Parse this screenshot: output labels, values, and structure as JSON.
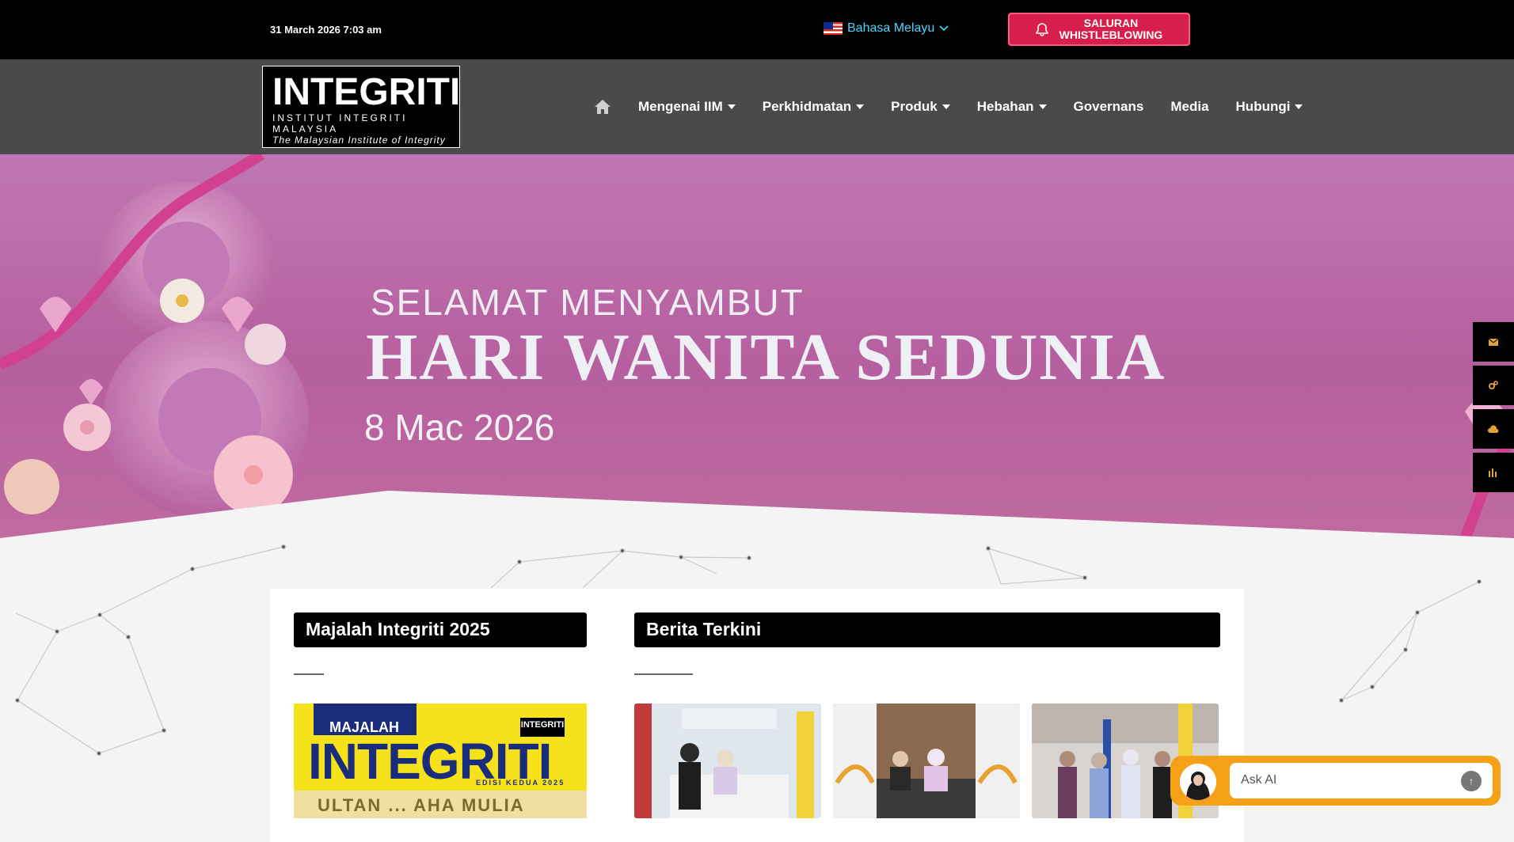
{
  "topbar": {
    "datetime": "31 March 2026 7:03 am",
    "language": "Bahasa Melayu",
    "whistleblowing_line1": "SALURAN",
    "whistleblowing_line2": "WHISTLEBLOWING"
  },
  "logo": {
    "title": "INTEGRITI",
    "subtitle": "INSTITUT INTEGRITI MALAYSIA",
    "english": "The Malaysian Institute of Integrity"
  },
  "nav": {
    "items": [
      {
        "label": "Mengenai IIM",
        "dropdown": true
      },
      {
        "label": "Perkhidmatan",
        "dropdown": true
      },
      {
        "label": "Produk",
        "dropdown": true
      },
      {
        "label": "Hebahan",
        "dropdown": true
      },
      {
        "label": "Governans",
        "dropdown": false
      },
      {
        "label": "Media",
        "dropdown": false
      },
      {
        "label": "Hubungi",
        "dropdown": true
      }
    ]
  },
  "hero": {
    "line1": "SELAMAT MENYAMBUT",
    "line2": "HARI WANITA SEDUNIA",
    "line3": "8 Mac 2026"
  },
  "sections": {
    "magazine_title": "Majalah Integriti 2025",
    "news_title": "Berita Terkini"
  },
  "magazine": {
    "majalah": "MAJALAH",
    "title": "INTEGRITI",
    "logo": "INTEGRITI",
    "edition": "EDISI KEDUA 2025",
    "strip": "ULTAN ... AHA MULIA"
  },
  "askai": {
    "placeholder": "Ask AI",
    "send_icon": "arrow-up-icon"
  },
  "colors": {
    "topbar": "#000000",
    "navbar": "#4a4a4a",
    "whistleblowing": "#d81e4a",
    "accessibility": "#e0a03a",
    "askai": "#f5a117",
    "hero": "#c076b4"
  }
}
